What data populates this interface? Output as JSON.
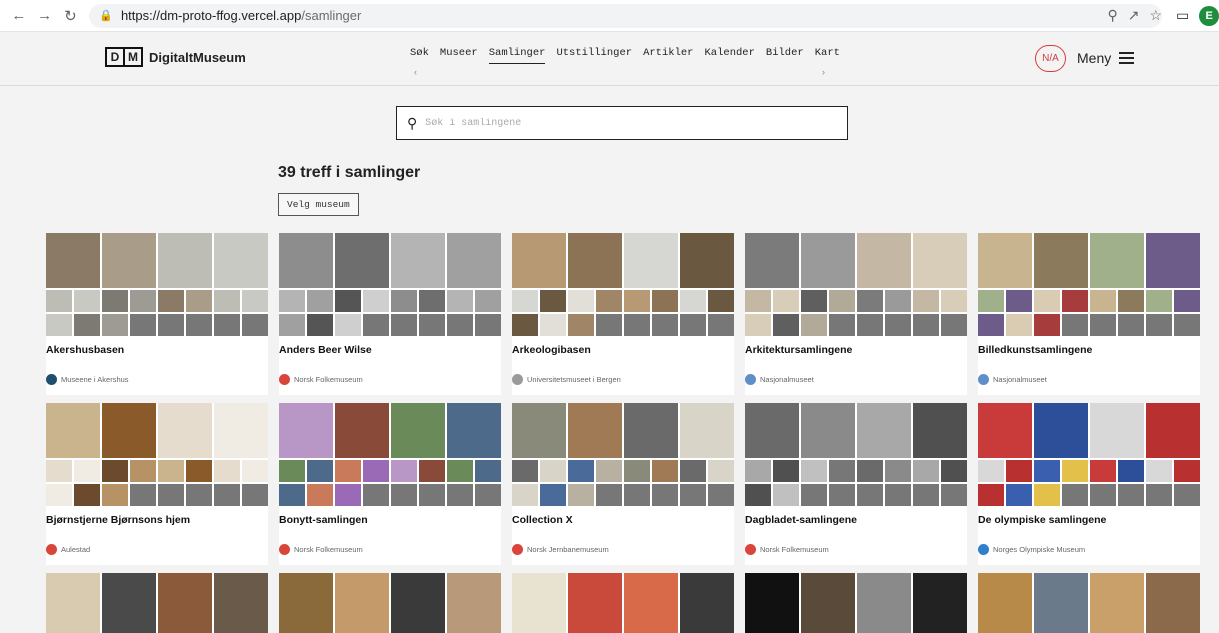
{
  "browser": {
    "url_host": "https://dm-proto-ffog.vercel.app",
    "url_path": "/samlinger",
    "profile_initial": "E"
  },
  "header": {
    "logo_letters": [
      "D",
      "M"
    ],
    "logo_name": "DigitaltMuseum",
    "nav": [
      "Søk",
      "Museer",
      "Samlinger",
      "Utstillinger",
      "Artikler",
      "Kalender",
      "Bilder",
      "Kart"
    ],
    "active_nav": "Samlinger",
    "badge": "N/A",
    "menu_label": "Meny"
  },
  "search": {
    "placeholder": "Søk i samlingene"
  },
  "results": {
    "title": "39 treff i samlinger",
    "filter_button": "Velg museum"
  },
  "cards": [
    {
      "title": "Akershusbasen",
      "museum": "Museene i Akershus",
      "museum_color": "#1f4e6e",
      "palette": [
        "#8a7a66",
        "#a99d8a",
        "#bdbdb6",
        "#c9c9c4",
        "#7d7a74",
        "#9e9b94"
      ]
    },
    {
      "title": "Anders Beer Wilse",
      "museum": "Norsk Folkemuseum",
      "museum_color": "#d9453b",
      "palette": [
        "#8d8d8d",
        "#6e6e6e",
        "#b4b4b4",
        "#a0a0a0",
        "#555555",
        "#cfcfcf"
      ]
    },
    {
      "title": "Arkeologibasen",
      "museum": "Universitetsmuseet i Bergen",
      "museum_color": "#9a9a9a",
      "palette": [
        "#b79a74",
        "#8d7355",
        "#d6d6d2",
        "#6b5840",
        "#e2dfd8",
        "#a08566"
      ]
    },
    {
      "title": "Arkitektursamlingene",
      "museum": "Nasjonalmuseet",
      "museum_color": "#5e8fc9",
      "palette": [
        "#7b7b7b",
        "#9a9a9a",
        "#c4b8a4",
        "#d8cdb8",
        "#5f5f5f",
        "#b2aa98"
      ]
    },
    {
      "title": "Billedkunstsamlingene",
      "museum": "Nasjonalmuseet",
      "museum_color": "#5e8fc9",
      "palette": [
        "#c8b48f",
        "#8c7a5c",
        "#9fb08a",
        "#6d5b8a",
        "#d9ccb2",
        "#a63c3c"
      ]
    },
    {
      "title": "Bjørnstjerne Bjørnsons hjem",
      "museum": "Aulestad",
      "museum_color": "#d9453b",
      "palette": [
        "#c9b48d",
        "#8a5a2b",
        "#e6dccd",
        "#f1ece3",
        "#6b4a2e",
        "#b79266"
      ]
    },
    {
      "title": "Bonytt-samlingen",
      "museum": "Norsk Folkemuseum",
      "museum_color": "#d9453b",
      "palette": [
        "#b896c6",
        "#8a4a3a",
        "#6b8a5a",
        "#4d6a8a",
        "#c97a5a",
        "#9a6ab6"
      ]
    },
    {
      "title": "Collection X",
      "museum": "Norsk Jernbanemuseum",
      "museum_color": "#d9453b",
      "palette": [
        "#8a8a7a",
        "#a07a55",
        "#6a6a6a",
        "#d8d4c8",
        "#4a6a9a",
        "#b8b0a0"
      ]
    },
    {
      "title": "Dagbladet-samlingene",
      "museum": "Norsk Folkemuseum",
      "museum_color": "#d9453b",
      "palette": [
        "#6a6a6a",
        "#8a8a8a",
        "#a8a8a8",
        "#505050",
        "#c0c0c0",
        "#777777"
      ]
    },
    {
      "title": "De olympiske samlingene",
      "museum": "Norges Olympiske Museum",
      "museum_color": "#2f7fc9",
      "palette": [
        "#c93a3a",
        "#2d4f9a",
        "#d8d8d8",
        "#b83030",
        "#3a5fae",
        "#e2c04a"
      ]
    },
    {
      "title": "",
      "museum": "",
      "museum_color": "#cccccc",
      "palette": [
        "#d9cbb0",
        "#4a4a4a",
        "#8a5a3a",
        "#6a5a4a",
        "#e2d8c6",
        "#5a4a3a"
      ]
    },
    {
      "title": "",
      "museum": "",
      "museum_color": "#cccccc",
      "palette": [
        "#8a6a3a",
        "#c49a6a",
        "#3a3a3a",
        "#b89a7a",
        "#a88a5a",
        "#6a4a2a"
      ]
    },
    {
      "title": "",
      "museum": "",
      "museum_color": "#cccccc",
      "palette": [
        "#e8e2d0",
        "#c94a3a",
        "#d86a4a",
        "#3a3a3a",
        "#f2d24a",
        "#e8d8c0"
      ]
    },
    {
      "title": "",
      "museum": "",
      "museum_color": "#cccccc",
      "palette": [
        "#111111",
        "#5a4a3a",
        "#8a8a8a",
        "#222222",
        "#3a3a3a",
        "#aaaaaa"
      ]
    },
    {
      "title": "",
      "museum": "",
      "museum_color": "#cccccc",
      "palette": [
        "#b88a4a",
        "#6a7a8a",
        "#c9a06a",
        "#8a6a4a",
        "#d2b07a",
        "#5a6a7a"
      ]
    }
  ]
}
